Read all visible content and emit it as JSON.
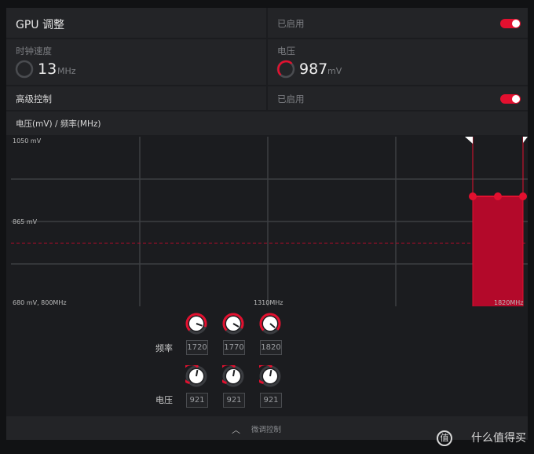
{
  "header": {
    "title": "GPU 调整",
    "status_label": "已启用",
    "toggle_on": true
  },
  "metrics": {
    "clock": {
      "label": "时钟速度",
      "value": "13",
      "unit": "MHz"
    },
    "voltage": {
      "label": "电压",
      "value": "987",
      "unit": "mV"
    }
  },
  "advanced": {
    "label": "高级控制",
    "status_label": "已启用",
    "toggle_on": true
  },
  "chart_section": {
    "title": "电压(mV) / 频率(MHz)"
  },
  "chart_data": {
    "type": "area",
    "title": "电压(mV) / 频率(MHz)",
    "y_tick_labels": [
      "1050 mV",
      "865 mV"
    ],
    "x_tick_labels": [
      "680 mV, 800MHz",
      "1310MHz",
      "1820MHz"
    ],
    "xlim": [
      800,
      1820
    ],
    "ylim": [
      680,
      1050
    ],
    "states": [
      {
        "freq_mhz": 1720,
        "voltage_mv": 921
      },
      {
        "freq_mhz": 1770,
        "voltage_mv": 921
      },
      {
        "freq_mhz": 1820,
        "voltage_mv": 921
      }
    ],
    "reference_voltage_mv": 818,
    "grid": true
  },
  "controls": {
    "freq_label": "频率",
    "voltage_label": "电压",
    "frequencies": [
      "1720",
      "1770",
      "1820"
    ],
    "voltages": [
      "921",
      "921",
      "921"
    ]
  },
  "footer": {
    "label": "微调控制"
  },
  "watermark": {
    "text": "值  什么值得买"
  },
  "colors": {
    "accent": "#e3102f",
    "fill": "#b3092a",
    "background": "#1b1c1f"
  }
}
